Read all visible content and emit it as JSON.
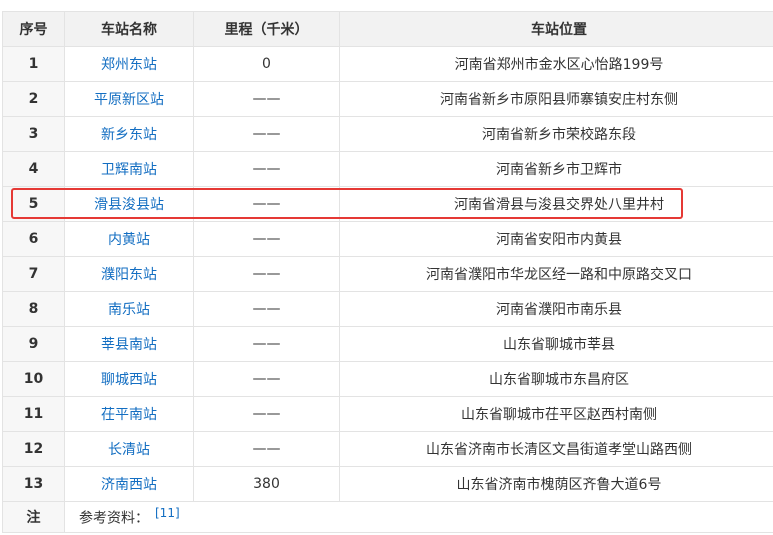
{
  "table": {
    "headers": [
      "序号",
      "车站名称",
      "里程（千米）",
      "车站位置"
    ],
    "rows": [
      {
        "no": "1",
        "name": "郑州东站",
        "mileage": "0",
        "location": "河南省郑州市金水区心怡路199号"
      },
      {
        "no": "2",
        "name": "平原新区站",
        "mileage": "——",
        "location": "河南省新乡市原阳县师寨镇安庄村东侧"
      },
      {
        "no": "3",
        "name": "新乡东站",
        "mileage": "——",
        "location": "河南省新乡市荣校路东段"
      },
      {
        "no": "4",
        "name": "卫辉南站",
        "mileage": "——",
        "location": "河南省新乡市卫辉市"
      },
      {
        "no": "5",
        "name": "滑县浚县站",
        "mileage": "——",
        "location": "河南省滑县与浚县交界处八里井村"
      },
      {
        "no": "6",
        "name": "内黄站",
        "mileage": "——",
        "location": "河南省安阳市内黄县"
      },
      {
        "no": "7",
        "name": "濮阳东站",
        "mileage": "——",
        "location": "河南省濮阳市华龙区经一路和中原路交叉口"
      },
      {
        "no": "8",
        "name": "南乐站",
        "mileage": "——",
        "location": "河南省濮阳市南乐县"
      },
      {
        "no": "9",
        "name": "莘县南站",
        "mileage": "——",
        "location": "山东省聊城市莘县"
      },
      {
        "no": "10",
        "name": "聊城西站",
        "mileage": "——",
        "location": "山东省聊城市东昌府区"
      },
      {
        "no": "11",
        "name": "茌平南站",
        "mileage": "——",
        "location": "山东省聊城市茌平区赵西村南侧"
      },
      {
        "no": "12",
        "name": "长清站",
        "mileage": "——",
        "location": "山东省济南市长清区文昌街道孝堂山路西侧"
      },
      {
        "no": "13",
        "name": "济南西站",
        "mileage": "380",
        "location": "山东省济南市槐荫区齐鲁大道6号"
      }
    ],
    "note": {
      "label": "注",
      "text": "参考资料：",
      "ref": "[11]"
    },
    "highlighted_row": "5",
    "colors": {
      "link": "#136ec2",
      "highlight": "#e53935",
      "header_bg": "#f2f2f2",
      "border": "#e3e3e3"
    }
  }
}
